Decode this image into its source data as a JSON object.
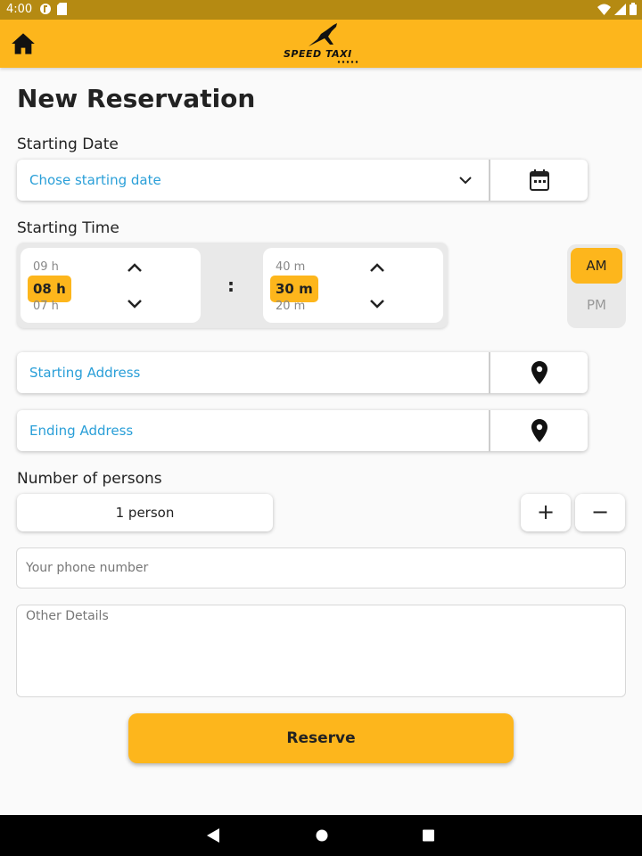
{
  "status_bar": {
    "time": "4:00",
    "left_icons": [
      "sync-icon",
      "sd-card-icon"
    ],
    "right_icons": [
      "wifi-icon",
      "signal-icon",
      "battery-icon"
    ]
  },
  "app_bar": {
    "home_icon": "home-icon",
    "logo_text": "SPEED TAXI",
    "color": "#fdb61c"
  },
  "page": {
    "title": "New Reservation"
  },
  "starting_date": {
    "label": "Starting Date",
    "placeholder": "Chose starting date",
    "dropdown_icon": "chevron-down-icon",
    "calendar_icon": "calendar-icon"
  },
  "starting_time": {
    "label": "Starting Time",
    "hours": {
      "prev": "09 h",
      "selected": "08 h",
      "next": "07 h"
    },
    "separator": ":",
    "minutes": {
      "prev": "40 m",
      "selected": "30 m",
      "next": "20 m"
    },
    "period": {
      "am": "AM",
      "pm": "PM",
      "selected": "AM"
    }
  },
  "starting_address": {
    "placeholder": "Starting Address",
    "icon": "location-pin-icon"
  },
  "ending_address": {
    "placeholder": "Ending Address",
    "icon": "location-pin-icon"
  },
  "persons": {
    "label": "Number of persons",
    "value": "1 person",
    "plus": "+",
    "minus": "−"
  },
  "phone": {
    "placeholder": "Your phone number",
    "value": ""
  },
  "details": {
    "placeholder": "Other Details",
    "value": ""
  },
  "reserve_button": {
    "label": "Reserve"
  },
  "nav_bar": {
    "back_icon": "back-triangle-icon",
    "home_icon": "home-circle-icon",
    "recents_icon": "recents-square-icon"
  },
  "colors": {
    "accent": "#fdb61c",
    "link_text": "#2a9fd8",
    "status_bar": "#b58a12"
  }
}
